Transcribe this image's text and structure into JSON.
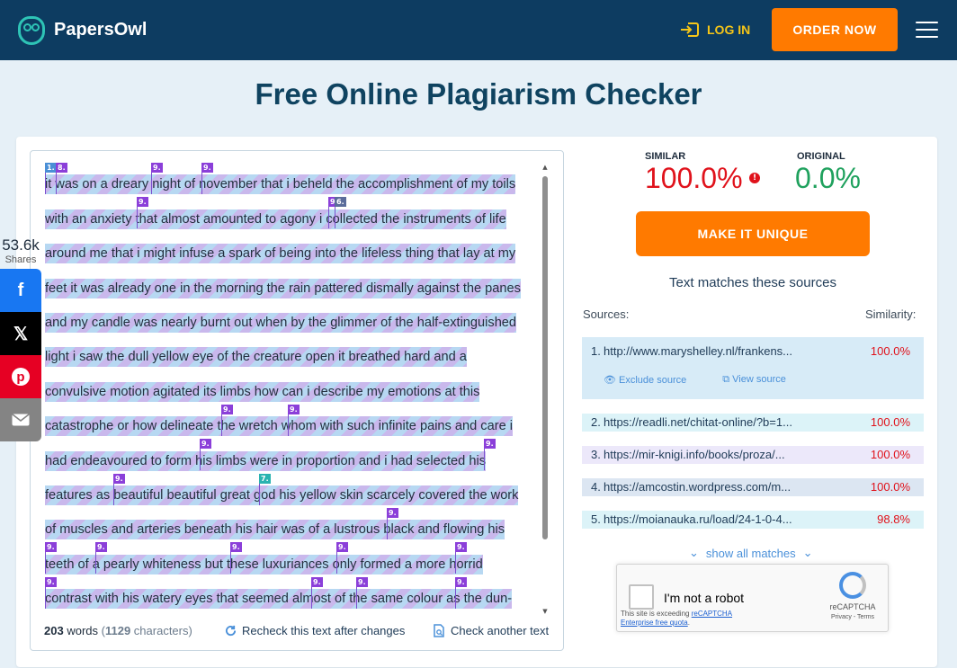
{
  "header": {
    "brand": "PapersOwl",
    "login": "LOG IN",
    "order_now": "ORDER NOW"
  },
  "page": {
    "title": "Free Online Plagiarism Checker"
  },
  "share": {
    "count": "53.6k",
    "label": "Shares",
    "buttons": [
      "facebook",
      "x",
      "pinterest",
      "email"
    ]
  },
  "text_lines": [
    "it was on a dreary night of november that i beheld the accomplishment of my toils",
    "with an anxiety that almost amounted to agony i collected the instruments of life",
    "around me that i might infuse a spark of being into the lifeless thing that lay at my",
    "feet it was already one in the morning the rain pattered dismally against the panes",
    "and my candle was nearly burnt out when by the glimmer of the half-extinguished",
    "light i saw the dull yellow eye of the creature open it breathed hard and a",
    "convulsive motion agitated its limbs how can i describe my emotions at this",
    "catastrophe or how delineate the wretch whom with such infinite pains and care i",
    "had endeavoured to form his limbs were in proportion and i had selected his",
    "features as beautiful beautiful great god his yellow skin scarcely covered the work",
    "of muscles and arteries beneath his hair was of a lustrous black and flowing his",
    "teeth of a pearly whiteness but these luxuriances only formed a more horrid",
    "contrast with his watery eyes that seemed almost of the same colour as the dun-"
  ],
  "textbox": {
    "word_count": "203",
    "words_label": "words",
    "char_count": "1129",
    "chars_label": "characters",
    "recheck": "Recheck this text after changes",
    "check_another": "Check another text"
  },
  "results": {
    "similar_label": "SIMILAR",
    "similar_value": "100.0%",
    "original_label": "ORIGINAL",
    "original_value": "0.0%",
    "make_unique": "MAKE IT UNIQUE",
    "matches_heading": "Text matches these sources",
    "sources_label": "Sources:",
    "similarity_label": "Similarity:",
    "sources": [
      {
        "idx": "1.",
        "url": "http://www.maryshelley.nl/frankens...",
        "pct": "100.0%"
      },
      {
        "idx": "2.",
        "url": "https://readli.net/chitat-online/?b=1...",
        "pct": "100.0%"
      },
      {
        "idx": "3.",
        "url": "https://mir-knigi.info/books/proza/...",
        "pct": "100.0%"
      },
      {
        "idx": "4.",
        "url": "https://amcostin.wordpress.com/m...",
        "pct": "100.0%"
      },
      {
        "idx": "5.",
        "url": "https://moianauka.ru/load/24-1-0-4...",
        "pct": "98.8%"
      }
    ],
    "exclude_source": "Exclude source",
    "view_source": "View source",
    "show_all": "show all matches",
    "colors": {
      "similar": "#e0121b",
      "original": "#1fa15d",
      "accent": "#ff7a00"
    }
  },
  "recaptcha": {
    "label": "I'm not a robot",
    "warning_line1": "This site is exceeding ",
    "warning_link1": "reCAPTCHA",
    "warning_link2": "Enterprise free quota",
    "warning_end": ".",
    "brand": "reCAPTCHA",
    "links": "Privacy - Terms"
  }
}
